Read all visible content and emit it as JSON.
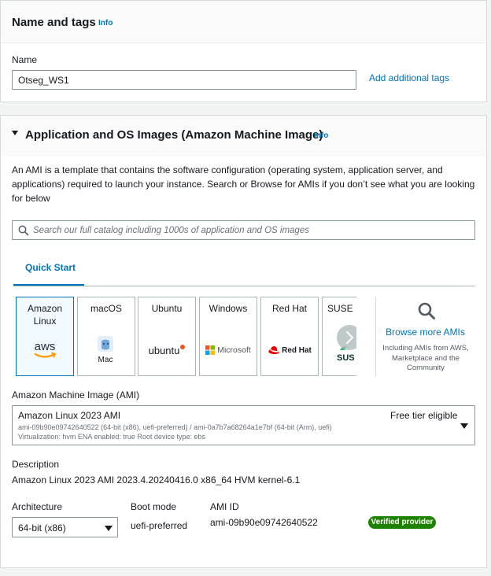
{
  "name_tags": {
    "title": "Name and tags",
    "info": "Info",
    "name_label": "Name",
    "name_value": "Otseg_WS1",
    "add_tags_link": "Add additional tags"
  },
  "ami_section": {
    "title": "Application and OS Images (Amazon Machine Image)",
    "info": "Info",
    "description": "An AMI is a template that contains the software configuration (operating system, application server, and applications) required to launch your instance. Search or Browse for AMIs if you don’t see what you are looking for below",
    "search_placeholder": "Search our full catalog including 1000s of application and OS images",
    "tab": "Quick Start",
    "os_tiles": [
      {
        "label_line1": "Amazon",
        "label_line2": "Linux",
        "logo": "aws",
        "selected": true
      },
      {
        "label_line1": "macOS",
        "logo": "Mac",
        "selected": false
      },
      {
        "label_line1": "Ubuntu",
        "logo": "ubuntu",
        "selected": false
      },
      {
        "label_line1": "Windows",
        "logo": "Microsoft",
        "selected": false
      },
      {
        "label_line1": "Red Hat",
        "logo": "Red Hat",
        "selected": false
      },
      {
        "label_line1": "SUSE L",
        "logo": "SUS",
        "selected": false
      }
    ],
    "browse": {
      "link": "Browse more AMIs",
      "subtitle": "Including AMIs from AWS, Marketplace and the Community"
    },
    "ami_label": "Amazon Machine Image (AMI)",
    "ami_selected": {
      "name": "Amazon Linux 2023 AMI",
      "ids": "ami-09b90e09742640522 (64-bit (x86), uefi-preferred) / ami-0a7b7a68264a1e7bf (64-bit (Arm), uefi)",
      "details": "Virtualization: hvm    ENA enabled: true    Root device type: ebs",
      "free_tier": "Free tier eligible"
    },
    "description_label": "Description",
    "description_value": "Amazon Linux 2023 AMI 2023.4.20240416.0 x86_64 HVM kernel-6.1",
    "architecture_label": "Architecture",
    "architecture_value": "64-bit (x86)",
    "boot_mode_label": "Boot mode",
    "boot_mode_value": "uefi-preferred",
    "ami_id_label": "AMI ID",
    "ami_id_value": "ami-09b90e09742640522",
    "verified_badge": "Verified provider"
  },
  "colors": {
    "link": "#0073bb",
    "badge_green": "#1d8102",
    "aws_orange": "#ff9900",
    "ubuntu_orange": "#e95420",
    "redhat_red": "#ee0000",
    "suse_green": "#30ba78"
  }
}
